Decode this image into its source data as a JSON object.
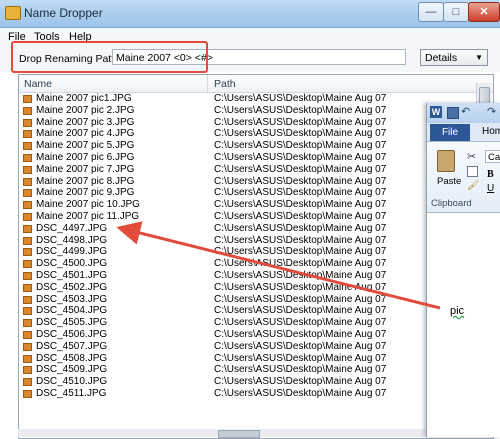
{
  "window": {
    "title": "Name Dropper"
  },
  "menu": {
    "items": [
      "File",
      "Tools",
      "Help"
    ]
  },
  "pattern": {
    "label": "Drop Renaming Pattern",
    "value": "Maine 2007 <0> <#>"
  },
  "view": {
    "selected": "Details"
  },
  "list": {
    "columns": {
      "name": "Name",
      "path": "Path"
    },
    "rows": [
      {
        "name": "Maine 2007 pic1.JPG",
        "path": "C:\\Users\\ASUS\\Desktop\\Maine Aug 07"
      },
      {
        "name": "Maine 2007 pic 2.JPG",
        "path": "C:\\Users\\ASUS\\Desktop\\Maine Aug 07"
      },
      {
        "name": "Maine 2007 pic 3.JPG",
        "path": "C:\\Users\\ASUS\\Desktop\\Maine Aug 07"
      },
      {
        "name": "Maine 2007 pic 4.JPG",
        "path": "C:\\Users\\ASUS\\Desktop\\Maine Aug 07"
      },
      {
        "name": "Maine 2007 pic 5.JPG",
        "path": "C:\\Users\\ASUS\\Desktop\\Maine Aug 07"
      },
      {
        "name": "Maine 2007 pic 6.JPG",
        "path": "C:\\Users\\ASUS\\Desktop\\Maine Aug 07"
      },
      {
        "name": "Maine 2007 pic 7.JPG",
        "path": "C:\\Users\\ASUS\\Desktop\\Maine Aug 07"
      },
      {
        "name": "Maine 2007 pic 8.JPG",
        "path": "C:\\Users\\ASUS\\Desktop\\Maine Aug 07"
      },
      {
        "name": "Maine 2007 pic 9.JPG",
        "path": "C:\\Users\\ASUS\\Desktop\\Maine Aug 07"
      },
      {
        "name": "Maine 2007 pic 10.JPG",
        "path": "C:\\Users\\ASUS\\Desktop\\Maine Aug 07"
      },
      {
        "name": "Maine 2007 pic 11.JPG",
        "path": "C:\\Users\\ASUS\\Desktop\\Maine Aug 07"
      },
      {
        "name": "DSC_4497.JPG",
        "path": "C:\\Users\\ASUS\\Desktop\\Maine Aug 07"
      },
      {
        "name": "DSC_4498.JPG",
        "path": "C:\\Users\\ASUS\\Desktop\\Maine Aug 07"
      },
      {
        "name": "DSC_4499.JPG",
        "path": "C:\\Users\\ASUS\\Desktop\\Maine Aug 07"
      },
      {
        "name": "DSC_4500.JPG",
        "path": "C:\\Users\\ASUS\\Desktop\\Maine Aug 07"
      },
      {
        "name": "DSC_4501.JPG",
        "path": "C:\\Users\\ASUS\\Desktop\\Maine Aug 07"
      },
      {
        "name": "DSC_4502.JPG",
        "path": "C:\\Users\\ASUS\\Desktop\\Maine Aug 07"
      },
      {
        "name": "DSC_4503.JPG",
        "path": "C:\\Users\\ASUS\\Desktop\\Maine Aug 07"
      },
      {
        "name": "DSC_4504.JPG",
        "path": "C:\\Users\\ASUS\\Desktop\\Maine Aug 07"
      },
      {
        "name": "DSC_4505.JPG",
        "path": "C:\\Users\\ASUS\\Desktop\\Maine Aug 07"
      },
      {
        "name": "DSC_4506.JPG",
        "path": "C:\\Users\\ASUS\\Desktop\\Maine Aug 07"
      },
      {
        "name": "DSC_4507.JPG",
        "path": "C:\\Users\\ASUS\\Desktop\\Maine Aug 07"
      },
      {
        "name": "DSC_4508.JPG",
        "path": "C:\\Users\\ASUS\\Desktop\\Maine Aug 07"
      },
      {
        "name": "DSC_4509.JPG",
        "path": "C:\\Users\\ASUS\\Desktop\\Maine Aug 07"
      },
      {
        "name": "DSC_4510.JPG",
        "path": "C:\\Users\\ASUS\\Desktop\\Maine Aug 07"
      },
      {
        "name": "DSC_4511.JPG",
        "path": "C:\\Users\\ASUS\\Desktop\\Maine Aug 07"
      }
    ]
  },
  "word": {
    "file_tab": "File",
    "home_tab": "Hom",
    "paste_label": "Paste",
    "font_box": "Ca",
    "bold": "B",
    "underline": "U",
    "clipboard_label": "Clipboard"
  },
  "dropped_text": "pic",
  "colors": {
    "highlight": "#e34c3a",
    "word_accent": "#2b5797"
  }
}
